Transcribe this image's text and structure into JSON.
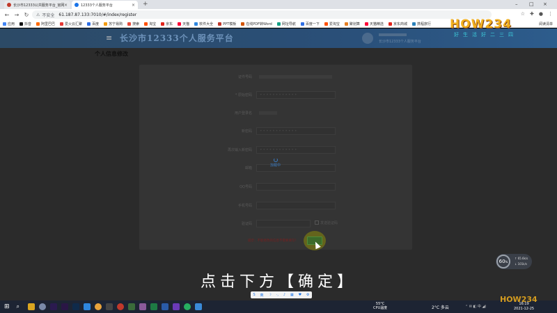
{
  "browser": {
    "tabs": [
      {
        "title": "长沙市12333公共服务平台_官网",
        "active": false
      },
      {
        "title": "12333个人服务平台",
        "active": true
      }
    ],
    "new_tab_icon": "plus-icon",
    "address": {
      "insecure_label": "不安全",
      "url": "61.187.87.133:7010/#/index/register"
    },
    "bookmarks": [
      "应用",
      "抖音",
      "阿里巴巴",
      "爱火云汇聚",
      "百度",
      "苏宁易购",
      "搜索",
      "淘宝",
      "京东",
      "天猫",
      "软件大全",
      "PPT模板",
      "在线PDF转Word",
      "网址导航",
      "百度一下",
      "爱淘宝",
      "聚划算",
      "天猫精选",
      "京东商城",
      "携程旅行"
    ],
    "reading_list": "阅读清单"
  },
  "site": {
    "title": "长沙市12333个人服务平台",
    "welcome": "长沙市12333个人服务平台"
  },
  "form": {
    "section_title": "个人信息修改",
    "fields": [
      {
        "label": "证件号码",
        "value": ""
      },
      {
        "label": "* 原始密码",
        "value": "••••••••••••"
      },
      {
        "label": "用户登录名",
        "value": ""
      },
      {
        "label": "新密码",
        "value": "••••••••••••"
      },
      {
        "label": "再次输入新密码",
        "value": "••••••••••••"
      },
      {
        "label": "邮箱",
        "value": ""
      },
      {
        "label": "QQ号码",
        "value": ""
      },
      {
        "label": "手机号码",
        "value": ""
      },
      {
        "label": "验证码",
        "value": ""
      }
    ],
    "loading_text": "加载中",
    "get_code_label": "发送验证码",
    "notice": "提示：不能修改的信息不需要填写！",
    "confirm_label": ""
  },
  "video": {
    "subtitle": "点击下方【确定】",
    "watermark_main": "HOW234",
    "watermark_slogan": "好生活好二三四"
  },
  "netmon": {
    "percent": "60",
    "unit": "%",
    "up": "65.6k/s",
    "down": "101k/s"
  },
  "taskbar": {
    "cpu_temp": "55°C",
    "cpu_label": "CPU温度",
    "weather": "2°C 多云",
    "time": "16:19",
    "date": "2021-12-25"
  }
}
